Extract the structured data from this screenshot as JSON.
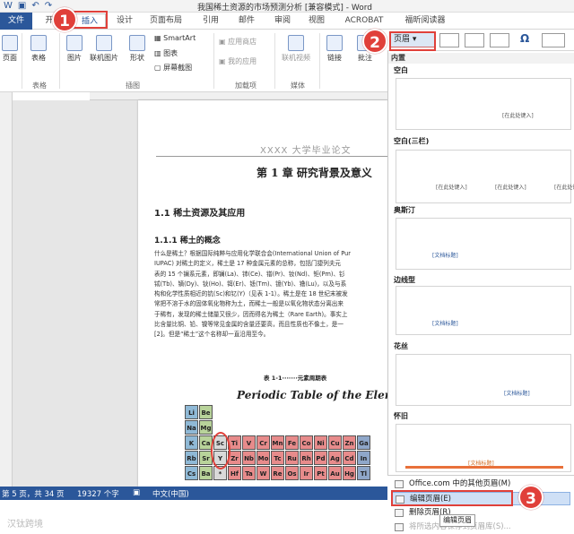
{
  "window": {
    "title": "我国稀土资源的市场预测分析 [兼容模式] - Word"
  },
  "tabs": [
    {
      "label": "文件"
    },
    {
      "label": "开"
    },
    {
      "label": "插入"
    },
    {
      "label": "设计"
    },
    {
      "label": "页面布局"
    },
    {
      "label": "引用"
    },
    {
      "label": "邮件"
    },
    {
      "label": "审阅"
    },
    {
      "label": "视图"
    },
    {
      "label": "ACROBAT"
    },
    {
      "label": "福昕阅读器"
    }
  ],
  "ribbon": {
    "page_label": "页面",
    "table_label": "表格",
    "table_group": "表格",
    "picture_label": "图片",
    "online_picture_label": "联机图片",
    "shapes_label": "形状",
    "smartart_label": "SmartArt",
    "chart_label": "图表",
    "screenshot_label": "屏幕截图",
    "illustrations_group": "插图",
    "app_store_label": "应用商店",
    "my_apps_label": "我的应用",
    "addins_group": "加载项",
    "online_video_label": "联机视频",
    "media_group": "媒体",
    "link_label": "链接",
    "comment_label": "批注",
    "header_button_label": "页眉",
    "header_icon": "dropdown-arrow-icon"
  },
  "document": {
    "header_text": "XXXX 大学毕业论文",
    "chapter_title": "第 1 章   研究背景及意义",
    "section_1_1": "1.1 稀土资源及其应用",
    "section_1_1_1": "1.1.1 稀土的概念",
    "paragraph_lines": [
      "什么是稀土？根据国际纯粹与应用化学联合会(International Union of Pur",
      "IUPAC) 对稀土的定义，稀土是 17 种金属元素的总称，包括门捷列夫元",
      "表的 15 个镧系元素，即镧(La)、铈(Ce)、镨(Pr)、钕(Nd)、钷(Pm)、钐",
      "铽(Tb)、镝(Dy)、钬(Ho)、铒(Er)、铥(Tm)、镱(Yb)、镥(Lu)，以及与系",
      "构和化学性质相近的钪(Sc)和钇(Y)（见表 1-1）。稀土是在 18 世纪末被发",
      "常把不溶于水的固体氧化物称为土，而稀土一般是以氧化物状态分离出来",
      "于稀有，发现的稀土储量又很少，因而得名为稀土（Rare Earth)。事实上",
      "比含量比铜、铅、镍等常见金属的含量还要高，而且性质也不像土，是一",
      "[2]。但是“稀土”这个名称却一直沿用至今。"
    ],
    "table_caption": "表 1-1·······元素周期表",
    "periodic_title": "Periodic Table of the Elements",
    "element_rows": [
      [
        "Li",
        "Be"
      ],
      [
        "Na",
        "Mg"
      ],
      [
        "K",
        "Ca",
        "Sc",
        "Ti",
        "V",
        "Cr",
        "Mn",
        "Fe",
        "Co",
        "Ni",
        "Cu",
        "Zn",
        "Ga"
      ],
      [
        "Rb",
        "Sr",
        "Y",
        "Zr",
        "Nb",
        "Mo",
        "Tc",
        "Ru",
        "Rh",
        "Pd",
        "Ag",
        "Cd",
        "In"
      ],
      [
        "Cs",
        "Ba",
        "*",
        "Hf",
        "Ta",
        "W",
        "Re",
        "Os",
        "Ir",
        "Pt",
        "Au",
        "Hg",
        "Tl"
      ]
    ]
  },
  "status": {
    "page": "第 5 页，共 34 页",
    "words": "19327 个字",
    "language": "中文(中国)"
  },
  "gallery": {
    "section_builtin": "内置",
    "items": [
      {
        "name": "空白",
        "text": "[在此处键入]"
      },
      {
        "name": "空白(三栏)",
        "text_left": "[在此处键入]",
        "text_mid": "[在此处键入]",
        "text_right": "[在此处键入]"
      },
      {
        "name": "奥斯汀",
        "text": "[文档标题]"
      },
      {
        "name": "边线型",
        "text": "[文档标题]"
      },
      {
        "name": "花丝",
        "text": "[文档标题]"
      },
      {
        "name": "怀旧",
        "text": "[文档标题]"
      }
    ]
  },
  "menu": {
    "more_headers": "Office.com 中的其他页眉(M)",
    "edit_header": "编辑页眉(E)",
    "remove_header": "删除页眉(R)",
    "save_selection": "将所选内容保存到页眉库(S)..."
  },
  "tooltip": "编辑页眉",
  "callouts": [
    "1",
    "2",
    "3"
  ],
  "watermark": "汉钛跨境",
  "colors": {
    "accent": "#2b579a",
    "callout": "#e0403a",
    "selection": "#cfe0f6"
  }
}
